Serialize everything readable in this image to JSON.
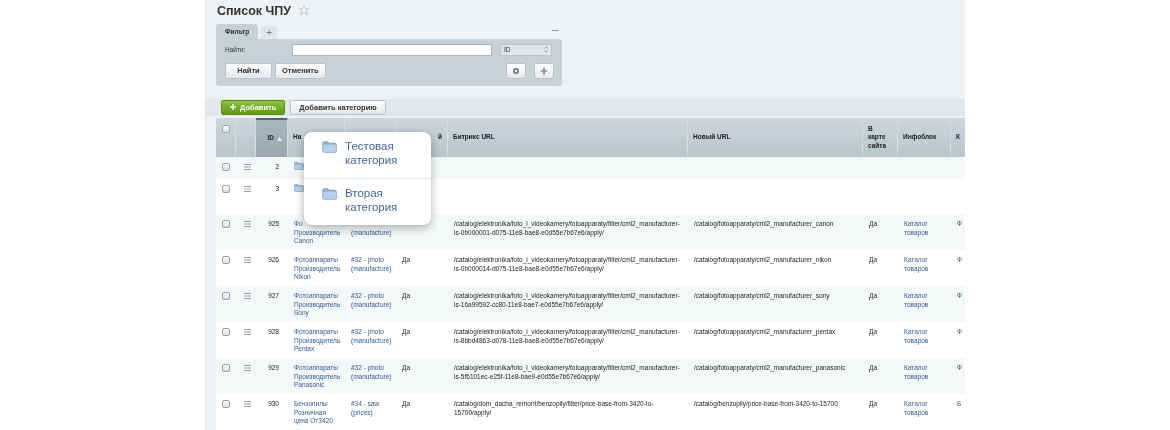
{
  "page": {
    "title": "Список ЧПУ",
    "favorite": false
  },
  "filter": {
    "tabs": [
      {
        "label": "Фильтр",
        "selected": true
      },
      {
        "label": "+",
        "selected": false
      }
    ],
    "find_label": "Найти:",
    "field": "ID",
    "buttons": [
      "Найти",
      "Отменить"
    ]
  },
  "toolbar": {
    "buttons": [
      {
        "label": "Добавить",
        "kind": "primary"
      },
      {
        "label": "Добавить категорию",
        "kind": "default"
      }
    ]
  },
  "table": {
    "header_checked": false,
    "columns": [
      {
        "label": [
          "ID"
        ],
        "sorted": true
      },
      {
        "label": [
          "На"
        ],
        "sorted": false
      },
      {
        "sorted": false
      },
      {
        "label": [
          "й"
        ],
        "sorted": false
      },
      {
        "label": [
          "Битрикс URL"
        ],
        "sorted": false
      },
      {
        "label": [
          "Новый URL"
        ],
        "sorted": false
      },
      {
        "label": [
          "В",
          "карте",
          "сайта"
        ],
        "sorted": false
      },
      {
        "label": [
          "Инфоблок"
        ],
        "sorted": false
      },
      {
        "label": [
          "К"
        ],
        "sorted": false
      }
    ],
    "rows": [
      {
        "kind": "category",
        "checked": false,
        "id": "2"
      },
      {
        "kind": "category",
        "checked": false,
        "id": "3"
      },
      {
        "kind": "item",
        "checked": false,
        "id": "925",
        "name": [
          "Фо",
          "Производитель",
          "Canon"
        ],
        "section": [
          "(manufacture)"
        ],
        "section_top_covered": true,
        "bitrix_url": [
          "/catalog/elektronika/foto_i_videokamery/fotoapparaty/filter/cml2_manufacturer-",
          "is-0b000001-d075-11e8-bae8-e0d55e7b67e6/apply/"
        ],
        "new_url": [
          "/catalog/fotoapparaty/cml2_manufacturer_canon"
        ],
        "in_sitemap": "Да",
        "iblock": [
          "Каталог",
          "товаров"
        ],
        "column_11": "Ф"
      },
      {
        "kind": "item",
        "checked": false,
        "id": "926",
        "name": [
          "Фотоаппараты",
          "Производитель",
          "Nikon"
        ],
        "section": [
          "#32 - photo",
          "(manufacture)"
        ],
        "active": "Да",
        "bitrix_url": [
          "/catalog/elektronika/foto_i_videokamery/fotoapparaty/filter/cml2_manufacturer-",
          "is-0b000014-d075-11e8-bae8-e0d55e7b67e6/apply/"
        ],
        "new_url": [
          "/catalog/fotoapparaty/cml2_manufacturer_nikon"
        ],
        "in_sitemap": "Да",
        "iblock": [
          "Каталог",
          "товаров"
        ],
        "column_11": "Ф"
      },
      {
        "kind": "item",
        "checked": false,
        "id": "927",
        "name": [
          "Фотоаппараты",
          "Производитель",
          "Sony"
        ],
        "section": [
          "#32 - photo",
          "(manufacture)"
        ],
        "active": "Да",
        "bitrix_url": [
          "/catalog/elektronika/foto_i_videokamery/fotoapparaty/filter/cml2_manufacturer-",
          "is-16a99592-cc80-11e8-bae7-e0d55e7b67e6/apply/"
        ],
        "new_url": [
          "/catalog/fotoapparaty/cml2_manufacturer_sony"
        ],
        "in_sitemap": "Да",
        "iblock": [
          "Каталог",
          "товаров"
        ],
        "column_11": "Ф"
      },
      {
        "kind": "item",
        "checked": false,
        "id": "928",
        "name": [
          "Фотоаппараты",
          "Производитель",
          "Pentax"
        ],
        "section": [
          "#32 - photo",
          "(manufacture)"
        ],
        "active": "Да",
        "bitrix_url": [
          "/catalog/elektronika/foto_i_videokamery/fotoapparaty/filter/cml2_manufacturer-",
          "is-8bbd4863-d078-11e8-bae8-e0d55e7b67e6/apply/"
        ],
        "new_url": [
          "/catalog/fotoapparaty/cml2_manufacturer_pentax"
        ],
        "in_sitemap": "Да",
        "iblock": [
          "Каталог",
          "товаров"
        ],
        "column_11": "Ф"
      },
      {
        "kind": "item",
        "checked": false,
        "id": "929",
        "name": [
          "Фотоаппараты",
          "Производитель",
          "Panasonic"
        ],
        "section": [
          "#32 - photo",
          "(manufacture)"
        ],
        "active": "Да",
        "bitrix_url": [
          "/catalog/elektronika/foto_i_videokamery/fotoapparaty/filter/cml2_manufacturer-",
          "is-5f6101ec-e25f-11e8-bae9-e0d55e7b67e6/apply/"
        ],
        "new_url": [
          "/catalog/fotoapparaty/cml2_manufacturer_panasonic"
        ],
        "in_sitemap": "Да",
        "iblock": [
          "Каталог",
          "товаров"
        ],
        "column_11": "Ф"
      },
      {
        "kind": "item",
        "checked": false,
        "id": "930",
        "name": [
          "Бензопилы",
          "Розничная",
          "цена От3420"
        ],
        "section": [
          "#34 - saw",
          "(prices)"
        ],
        "active": "Да",
        "bitrix_url": [
          "/catalog/dom_dacha_remont/benzopily/filter/price-base-from-3420-to-",
          "15700/apply/"
        ],
        "new_url": [
          "/catalog/benzopily/price-base-from-3420-to-15700"
        ],
        "in_sitemap": "Да",
        "iblock": [
          "Каталог",
          "товаров"
        ],
        "column_11": "Б"
      }
    ]
  },
  "popup": {
    "items": [
      {
        "label": [
          "Тестовая",
          "категория"
        ]
      },
      {
        "label": [
          "Вторая",
          "категория"
        ]
      }
    ]
  }
}
